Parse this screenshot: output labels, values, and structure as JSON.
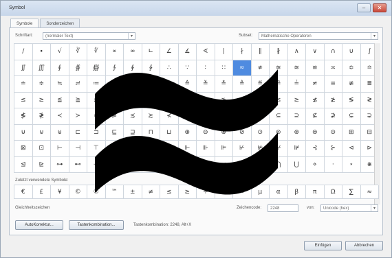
{
  "window": {
    "title": "Symbol",
    "minimize": "–",
    "close": "✕"
  },
  "tabs": [
    {
      "label": "Symbole"
    },
    {
      "label": "Sonderzeichen"
    }
  ],
  "font": {
    "label": "Schriftart:",
    "value": "(normaler Text)"
  },
  "subset": {
    "label": "Subset:",
    "value": "Mathematische Operatoren"
  },
  "grid_rows": [
    [
      "∕",
      "∙",
      "√",
      "∛",
      "∜",
      "∝",
      "∞",
      "∟",
      "∠",
      "∡",
      "∢",
      "∣",
      "∤",
      "∥",
      "∦",
      "∧",
      "∨",
      "∩",
      "∪",
      "∫"
    ],
    [
      "∬",
      "∭",
      "∮",
      "∯",
      "∰",
      "∱",
      "∲",
      "∳",
      "∴",
      "∵",
      "∶",
      "∷",
      "≈",
      "≉",
      "≊",
      "≋",
      "≌",
      "≍",
      "≎",
      "≏"
    ],
    [
      "≐",
      "≑",
      "≒",
      "≓",
      "≔",
      "≕",
      "≖",
      "≗",
      "≘",
      "≙",
      "≚",
      "≛",
      "≜",
      "≝",
      "≞",
      "≟",
      "≠",
      "≡",
      "≢",
      "≣"
    ],
    [
      "≤",
      "≥",
      "≦",
      "≧",
      "≨",
      "≩",
      "≪",
      "≫",
      "≬",
      "≭",
      "≮",
      "≯",
      "≰",
      "≱",
      "≲",
      "≳",
      "≴",
      "≵",
      "≶",
      "≷"
    ],
    [
      "≸",
      "≹",
      "≺",
      "≻",
      "≼",
      "≽",
      "≾",
      "≿",
      "⊀",
      "⊁",
      "⊂",
      "⊃",
      "⊄",
      "⊅",
      "⊆",
      "⊇",
      "⊈",
      "⊉",
      "⊊",
      "⊋"
    ],
    [
      "⊌",
      "⊍",
      "⊎",
      "⊏",
      "⊐",
      "⊑",
      "⊒",
      "⊓",
      "⊔",
      "⊕",
      "⊖",
      "⊗",
      "⊘",
      "⊙",
      "⊚",
      "⊛",
      "⊜",
      "⊝",
      "⊞",
      "⊟"
    ],
    [
      "⊠",
      "⊡",
      "⊢",
      "⊣",
      "⊤",
      "⊥",
      "⊦",
      "⊧",
      "⊨",
      "⊩",
      "⊪",
      "⊫",
      "⊬",
      "⊭",
      "⊮",
      "⊯",
      "⊰",
      "⊱",
      "⊲",
      "⊳"
    ],
    [
      "⊴",
      "⊵",
      "⊶",
      "⊷",
      "⊸",
      "⊹",
      "⊺",
      "⊻",
      "⊼",
      "⊽",
      "⊾",
      "⊿",
      "⋀",
      "⋁",
      "⋂",
      "⋃",
      "⋄",
      "⋅",
      "⋆",
      "⋇"
    ]
  ],
  "recent_label": "Zuletzt verwendete Symbole:",
  "recent_row": [
    "€",
    "£",
    "¥",
    "©",
    "®",
    "™",
    "±",
    "≠",
    "≤",
    "≥",
    "÷",
    "×",
    "∞",
    "µ",
    "α",
    "β",
    "π",
    "Ω",
    "∑",
    "≈"
  ],
  "char_name": "Gleichheitszeichen",
  "char_code_label": "Zeichencode:",
  "char_code_value": "2248",
  "from_label": "von:",
  "from_value": "Unicode (hex)",
  "autocorrect_label": "AutoKorrektur...",
  "shortcut_button_label": "Tastenkombination...",
  "shortcut_text": "Tastenkombination: 2248, Alt+X",
  "insert_label": "Einfügen",
  "cancel_label": "Abbrechen",
  "overlay_symbol": "≈",
  "colors": {
    "selected": "#4f8be0"
  }
}
